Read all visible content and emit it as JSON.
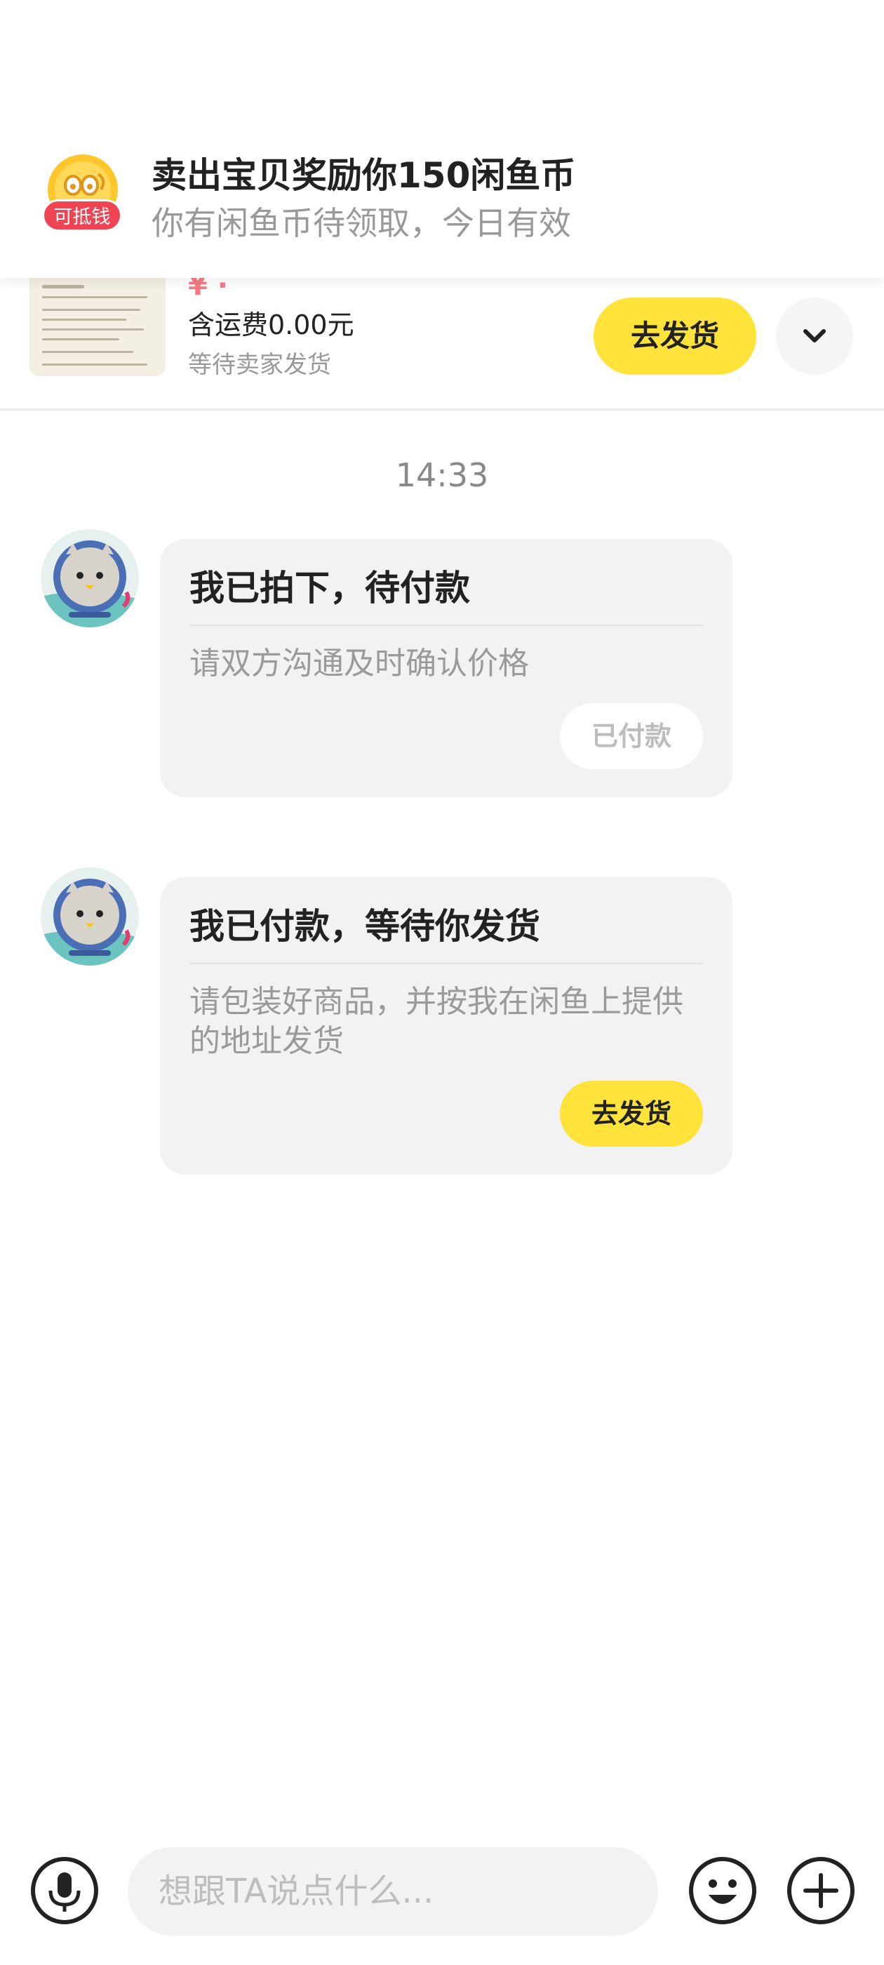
{
  "notification": {
    "badge": "可抵钱",
    "title": "卖出宝贝奖励你150闲鱼币",
    "subtitle": "你有闲鱼币待领取，今日有效"
  },
  "product": {
    "shipping_fee": "含运费0.00元",
    "status": "等待卖家发货",
    "ship_button": "去发货"
  },
  "chat": {
    "time": "14:33",
    "messages": [
      {
        "title": "我已拍下，待付款",
        "description": "请双方沟通及时确认价格",
        "button": "已付款"
      },
      {
        "title": "我已付款，等待你发货",
        "description": "请包装好商品，并按我在闲鱼上提供的地址发货",
        "button": "去发货"
      }
    ]
  },
  "input": {
    "placeholder": "想跟TA说点什么..."
  },
  "colors": {
    "accent_yellow": "#ffe33b",
    "badge_red": "#f04452",
    "card_bg": "#f2f2f3"
  }
}
